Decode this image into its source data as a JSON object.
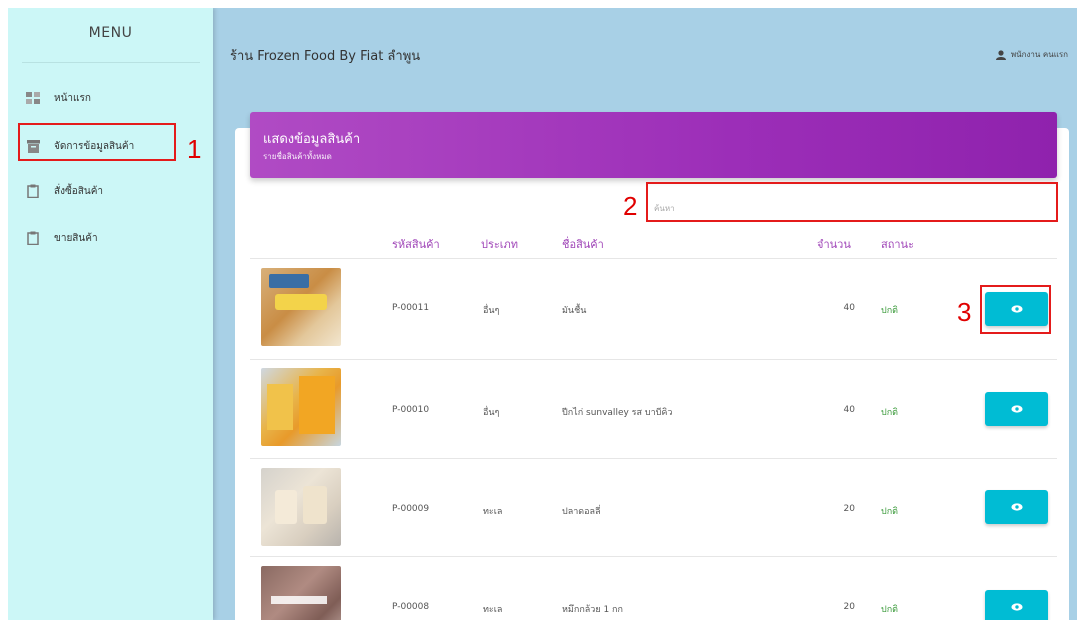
{
  "sidebar": {
    "title": "MENU",
    "items": [
      {
        "label": "หน้าแรก",
        "icon": "dashboard-icon"
      },
      {
        "label": "จัดการข้อมูลสินค้า",
        "icon": "archive-icon"
      },
      {
        "label": "สั่งซื้อสินค้า",
        "icon": "clipboard-icon"
      },
      {
        "label": "ขายสินค้า",
        "icon": "clipboard-icon"
      }
    ]
  },
  "topbar": {
    "title": "ร้าน Frozen Food By Fiat ลำพูน",
    "user": "พนักงาน คนแรก"
  },
  "card": {
    "title": "แสดงข้อมูลสินค้า",
    "subtitle": "รายชื่อสินค้าทั้งหมด"
  },
  "search": {
    "placeholder": "ค้นหา"
  },
  "annotations": [
    "1",
    "2",
    "3"
  ],
  "table": {
    "headers": [
      "รหัสสินค้า",
      "ประเภท",
      "ชื่อสินค้า",
      "จำนวน",
      "สถานะ"
    ],
    "rows": [
      {
        "code": "P-00011",
        "type": "อื่นๆ",
        "name": "มันชื้น",
        "qty": "40",
        "status": "ปกติ"
      },
      {
        "code": "P-00010",
        "type": "อื่นๆ",
        "name": "ปีกไก่ sunvalley รส บาบีคิว",
        "qty": "40",
        "status": "ปกติ"
      },
      {
        "code": "P-00009",
        "type": "ทะเล",
        "name": "ปลาดอลลี่",
        "qty": "20",
        "status": "ปกติ"
      },
      {
        "code": "P-00008",
        "type": "ทะเล",
        "name": "หมึกกล้วย 1 กก",
        "qty": "20",
        "status": "ปกติ"
      }
    ]
  },
  "colors": {
    "accent_purple": "#9c2eb8",
    "button_cyan": "#00bcd4",
    "status_green": "#3a9a3a",
    "annotation_red": "#e41b1b"
  }
}
